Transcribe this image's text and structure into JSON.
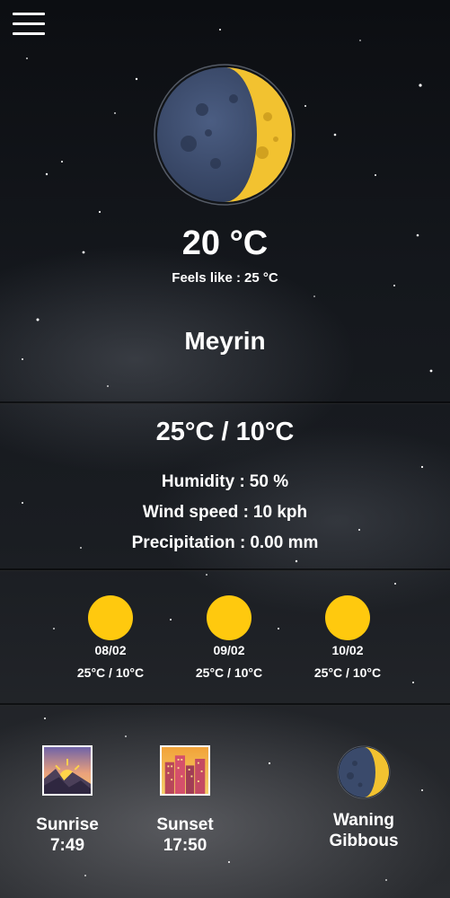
{
  "header": {
    "menu_icon": "hamburger-menu-icon"
  },
  "current": {
    "moon_icon": "waning-gibbous-moon-icon",
    "temperature": "20 °C",
    "feels_like_label": "Feels like :",
    "feels_like_value": "25 °C",
    "city": "Meyrin"
  },
  "details": {
    "min_max": "25°C / 10°C",
    "humidity_label": "Humidity :",
    "humidity_value": "50 %",
    "wind_label": "Wind speed :",
    "wind_value": "10 kph",
    "precip_label": "Precipitation :",
    "precip_value": "0.00 mm"
  },
  "forecast": [
    {
      "icon": "sun-icon",
      "date": "08/02",
      "range": "25°C / 10°C"
    },
    {
      "icon": "sun-icon",
      "date": "09/02",
      "range": "25°C / 10°C"
    },
    {
      "icon": "sun-icon",
      "date": "10/02",
      "range": "25°C / 10°C"
    }
  ],
  "astro": {
    "sunrise_icon": "sunrise-icon",
    "sunrise_label": "Sunrise",
    "sunrise_time": "7:49",
    "sunset_icon": "sunset-city-icon",
    "sunset_label": "Sunset",
    "sunset_time": "17:50",
    "moon_phase_icon": "waning-gibbous-moon-icon",
    "moon_phase_line1": "Waning",
    "moon_phase_line2": "Gibbous"
  },
  "colors": {
    "sun": "#ffc90e",
    "moon_lit": "#f2c230",
    "moon_dark": "#3a4a6b",
    "text": "#ffffff"
  }
}
